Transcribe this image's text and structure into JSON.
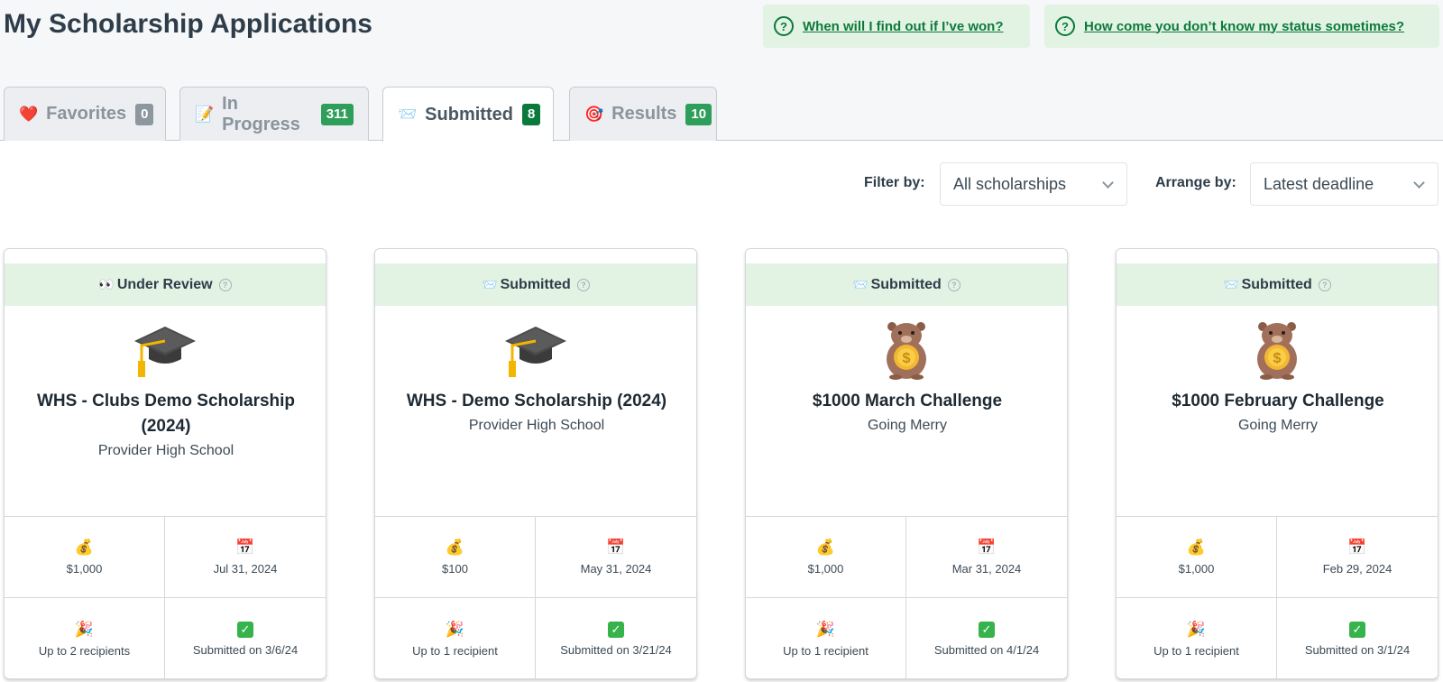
{
  "page": {
    "title": "My Scholarship Applications"
  },
  "help_links": [
    {
      "label": "When will I find out if I’ve won?"
    },
    {
      "label": "How come you don’t know my status sometimes?"
    }
  ],
  "tabs": [
    {
      "label": "Favorites",
      "emoji": "❤️",
      "count": "0"
    },
    {
      "label": "In Progress",
      "emoji": "📝",
      "count": "311"
    },
    {
      "label": "Submitted",
      "emoji": "📨",
      "count": "8"
    },
    {
      "label": "Results",
      "emoji": "🎯",
      "count": "10"
    }
  ],
  "filter": {
    "label": "Filter by:",
    "value": "All scholarships"
  },
  "arrange": {
    "label": "Arrange by:",
    "value": "Latest deadline"
  },
  "cards": [
    {
      "status_emoji": "👀",
      "status": "Under Review",
      "icon": "graduation-cap-icon",
      "title": "WHS - Clubs Demo Scholarship (2024)",
      "provider": "Provider High School",
      "amount_emoji": "💰",
      "amount": "$1,000",
      "deadline_emoji": "📅",
      "deadline": "Jul 31, 2024",
      "recipients_emoji": "🎉",
      "recipients": "Up to 2 recipients",
      "submitted": "Submitted on 3/6/24"
    },
    {
      "status_emoji": "📨",
      "status": "Submitted",
      "icon": "graduation-cap-icon",
      "title": "WHS - Demo Scholarship (2024)",
      "provider": "Provider High School",
      "amount_emoji": "💰",
      "amount": "$100",
      "deadline_emoji": "📅",
      "deadline": "May 31, 2024",
      "recipients_emoji": "🎉",
      "recipients": "Up to 1 recipient",
      "submitted": "Submitted on 3/21/24"
    },
    {
      "status_emoji": "📨",
      "status": "Submitted",
      "icon": "beaver-coin-icon",
      "title": "$1000 March Challenge",
      "provider": "Going Merry",
      "amount_emoji": "💰",
      "amount": "$1,000",
      "deadline_emoji": "📅",
      "deadline": "Mar 31, 2024",
      "recipients_emoji": "🎉",
      "recipients": "Up to 1 recipient",
      "submitted": "Submitted on 4/1/24"
    },
    {
      "status_emoji": "📨",
      "status": "Submitted",
      "icon": "beaver-coin-icon",
      "title": "$1000 February Challenge",
      "provider": "Going Merry",
      "amount_emoji": "💰",
      "amount": "$1,000",
      "deadline_emoji": "📅",
      "deadline": "Feb 29, 2024",
      "recipients_emoji": "🎉",
      "recipients": "Up to 1 recipient",
      "submitted": "Submitted on 3/1/24"
    }
  ],
  "colors": {
    "accent_green": "#0d7a3a",
    "status_bg": "#e2f3e4",
    "badge_green": "#2e9e5b"
  }
}
